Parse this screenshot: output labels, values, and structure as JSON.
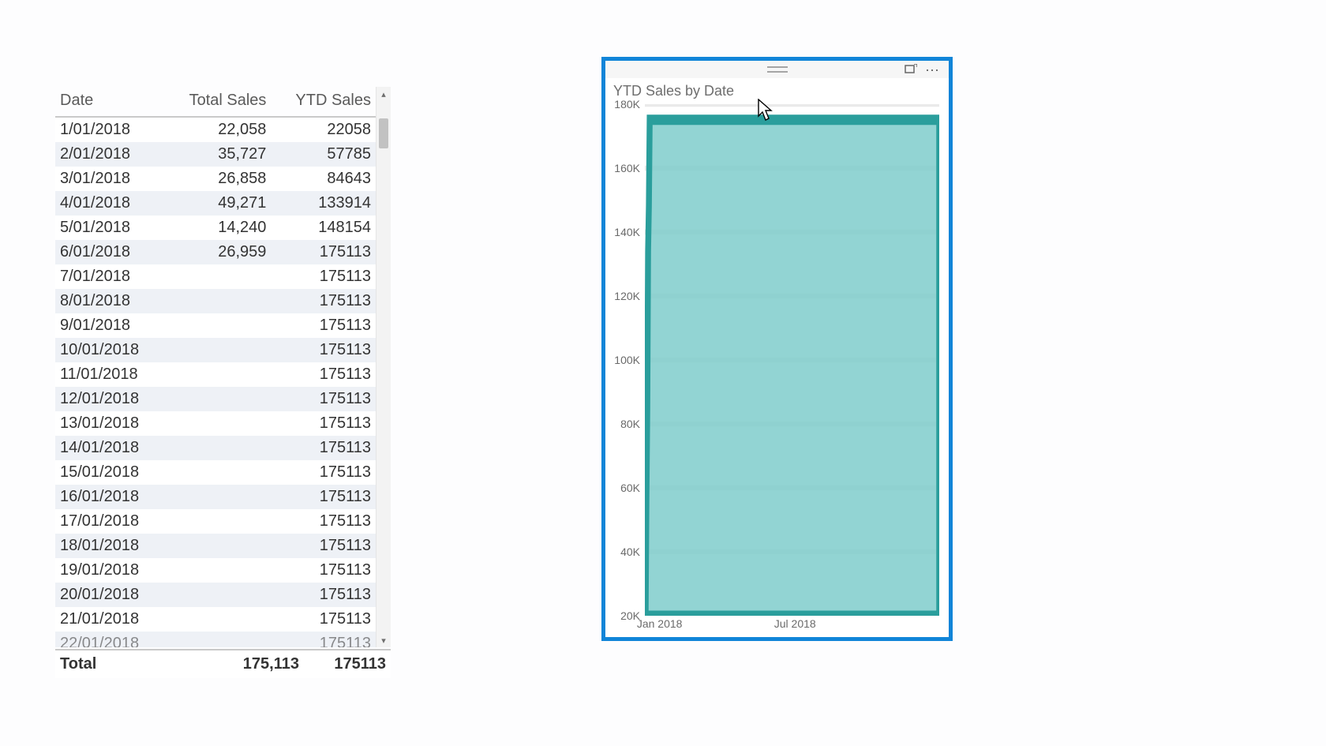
{
  "table": {
    "headers": [
      "Date",
      "Total Sales",
      "YTD Sales"
    ],
    "rows": [
      {
        "date": "1/01/2018",
        "total": "22,058",
        "ytd": "22058"
      },
      {
        "date": "2/01/2018",
        "total": "35,727",
        "ytd": "57785"
      },
      {
        "date": "3/01/2018",
        "total": "26,858",
        "ytd": "84643"
      },
      {
        "date": "4/01/2018",
        "total": "49,271",
        "ytd": "133914"
      },
      {
        "date": "5/01/2018",
        "total": "14,240",
        "ytd": "148154"
      },
      {
        "date": "6/01/2018",
        "total": "26,959",
        "ytd": "175113"
      },
      {
        "date": "7/01/2018",
        "total": "",
        "ytd": "175113"
      },
      {
        "date": "8/01/2018",
        "total": "",
        "ytd": "175113"
      },
      {
        "date": "9/01/2018",
        "total": "",
        "ytd": "175113"
      },
      {
        "date": "10/01/2018",
        "total": "",
        "ytd": "175113"
      },
      {
        "date": "11/01/2018",
        "total": "",
        "ytd": "175113"
      },
      {
        "date": "12/01/2018",
        "total": "",
        "ytd": "175113"
      },
      {
        "date": "13/01/2018",
        "total": "",
        "ytd": "175113"
      },
      {
        "date": "14/01/2018",
        "total": "",
        "ytd": "175113"
      },
      {
        "date": "15/01/2018",
        "total": "",
        "ytd": "175113"
      },
      {
        "date": "16/01/2018",
        "total": "",
        "ytd": "175113"
      },
      {
        "date": "17/01/2018",
        "total": "",
        "ytd": "175113"
      },
      {
        "date": "18/01/2018",
        "total": "",
        "ytd": "175113"
      },
      {
        "date": "19/01/2018",
        "total": "",
        "ytd": "175113"
      },
      {
        "date": "20/01/2018",
        "total": "",
        "ytd": "175113"
      },
      {
        "date": "21/01/2018",
        "total": "",
        "ytd": "175113"
      },
      {
        "date": "22/01/2018",
        "total": "",
        "ytd": "175113"
      }
    ],
    "footer": {
      "label": "Total",
      "total": "175,113",
      "ytd": "175113"
    }
  },
  "chart": {
    "title": "YTD Sales by Date",
    "y_ticks": [
      180000,
      160000,
      140000,
      120000,
      100000,
      80000,
      60000,
      40000,
      20000
    ],
    "y_tick_labels": [
      "180K",
      "160K",
      "140K",
      "120K",
      "100K",
      "80K",
      "60K",
      "40K",
      "20K"
    ],
    "x_tick_labels": [
      "Jan 2018",
      "Jul 2018"
    ],
    "x_tick_positions_pct": [
      5,
      51
    ]
  },
  "chart_data": {
    "type": "area",
    "title": "YTD Sales by Date",
    "xlabel": "",
    "ylabel": "",
    "ylim": [
      20000,
      180000
    ],
    "x": [
      "2018-01-01",
      "2018-01-02",
      "2018-01-03",
      "2018-01-04",
      "2018-01-05",
      "2018-01-06",
      "2018-12-31"
    ],
    "series": [
      {
        "name": "YTD Sales",
        "values": [
          22058,
          57785,
          84643,
          133914,
          148154,
          175113,
          175113
        ]
      }
    ],
    "fill_color": "#7fcccb",
    "line_color": "#2a9e9c"
  },
  "icons": {
    "focus": "⤢",
    "more": "⋯"
  }
}
